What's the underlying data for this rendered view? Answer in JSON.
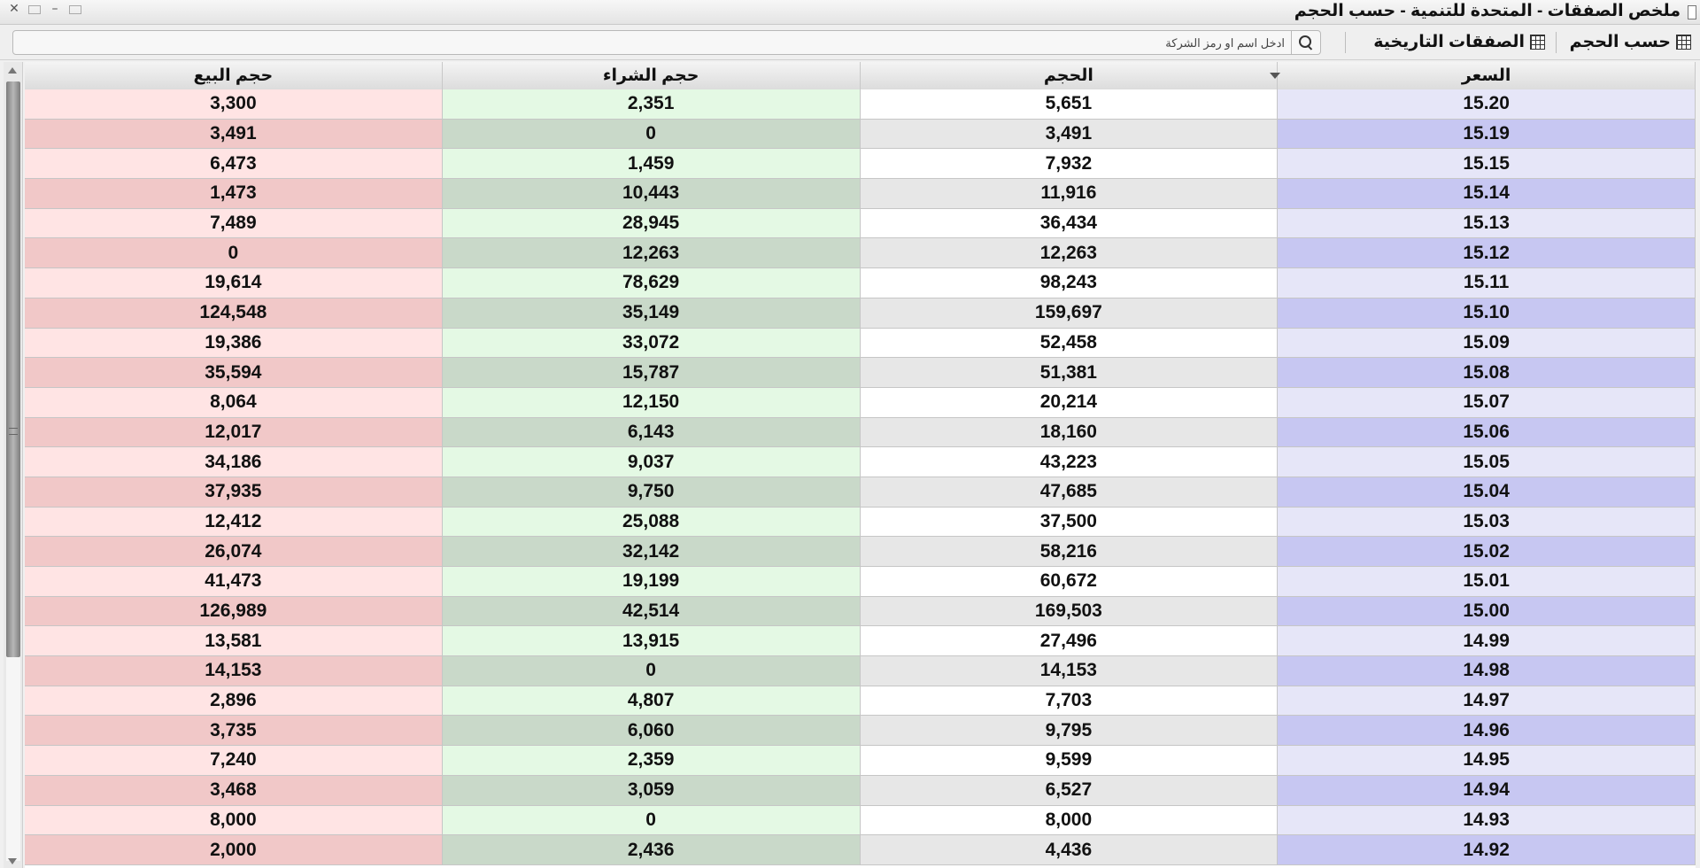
{
  "window": {
    "title": "ملخص الصفقات - المتحدة للتنمية - حسب الحجم",
    "controls": [
      "close",
      "restore",
      "minimize",
      "maximize"
    ]
  },
  "toolbar": {
    "by_volume_label": "حسب الحجم",
    "historical_trades_label": "الصفقات التاريخية",
    "search_placeholder": "ادخل اسم او رمز الشركة",
    "search_value": ""
  },
  "table": {
    "headers": {
      "price": "السعر",
      "volume": "الحجم",
      "buy_volume": "حجم الشراء",
      "sell_volume": "حجم البيع"
    },
    "sort_column": "price",
    "sort_direction": "descending",
    "rows": [
      {
        "price": "15.20",
        "volume": "5,651",
        "buy": "2,351",
        "sell": "3,300"
      },
      {
        "price": "15.19",
        "volume": "3,491",
        "buy": "0",
        "sell": "3,491"
      },
      {
        "price": "15.15",
        "volume": "7,932",
        "buy": "1,459",
        "sell": "6,473"
      },
      {
        "price": "15.14",
        "volume": "11,916",
        "buy": "10,443",
        "sell": "1,473"
      },
      {
        "price": "15.13",
        "volume": "36,434",
        "buy": "28,945",
        "sell": "7,489"
      },
      {
        "price": "15.12",
        "volume": "12,263",
        "buy": "12,263",
        "sell": "0"
      },
      {
        "price": "15.11",
        "volume": "98,243",
        "buy": "78,629",
        "sell": "19,614"
      },
      {
        "price": "15.10",
        "volume": "159,697",
        "buy": "35,149",
        "sell": "124,548"
      },
      {
        "price": "15.09",
        "volume": "52,458",
        "buy": "33,072",
        "sell": "19,386"
      },
      {
        "price": "15.08",
        "volume": "51,381",
        "buy": "15,787",
        "sell": "35,594"
      },
      {
        "price": "15.07",
        "volume": "20,214",
        "buy": "12,150",
        "sell": "8,064"
      },
      {
        "price": "15.06",
        "volume": "18,160",
        "buy": "6,143",
        "sell": "12,017"
      },
      {
        "price": "15.05",
        "volume": "43,223",
        "buy": "9,037",
        "sell": "34,186"
      },
      {
        "price": "15.04",
        "volume": "47,685",
        "buy": "9,750",
        "sell": "37,935"
      },
      {
        "price": "15.03",
        "volume": "37,500",
        "buy": "25,088",
        "sell": "12,412"
      },
      {
        "price": "15.02",
        "volume": "58,216",
        "buy": "32,142",
        "sell": "26,074"
      },
      {
        "price": "15.01",
        "volume": "60,672",
        "buy": "19,199",
        "sell": "41,473"
      },
      {
        "price": "15.00",
        "volume": "169,503",
        "buy": "42,514",
        "sell": "126,989"
      },
      {
        "price": "14.99",
        "volume": "27,496",
        "buy": "13,915",
        "sell": "13,581"
      },
      {
        "price": "14.98",
        "volume": "14,153",
        "buy": "0",
        "sell": "14,153"
      },
      {
        "price": "14.97",
        "volume": "7,703",
        "buy": "4,807",
        "sell": "2,896"
      },
      {
        "price": "14.96",
        "volume": "9,795",
        "buy": "6,060",
        "sell": "3,735"
      },
      {
        "price": "14.95",
        "volume": "9,599",
        "buy": "2,359",
        "sell": "7,240"
      },
      {
        "price": "14.94",
        "volume": "6,527",
        "buy": "3,059",
        "sell": "3,468"
      },
      {
        "price": "14.93",
        "volume": "8,000",
        "buy": "0",
        "sell": "8,000"
      },
      {
        "price": "14.92",
        "volume": "4,436",
        "buy": "2,436",
        "sell": "2,000"
      }
    ]
  },
  "colors": {
    "sell_light": "#ffe4e4",
    "sell_dark": "#f1c8c8",
    "buy_light": "#e4f9e4",
    "buy_dark": "#c9d9c9",
    "price_light": "#e6e6f8",
    "price_dark": "#c7c7f2"
  },
  "icons": {
    "close": "close-icon",
    "restore": "restore-icon",
    "minimize": "minimize-icon",
    "maximize": "maximize-icon",
    "search": "search-icon",
    "grid": "grid-icon",
    "sort": "sort-descending-icon"
  }
}
